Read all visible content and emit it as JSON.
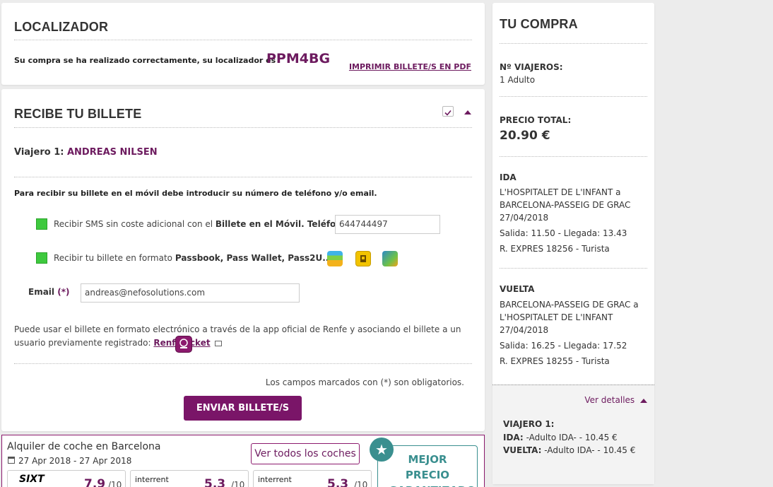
{
  "localizador": {
    "title": "LOCALIZADOR",
    "message": "Su compra se ha realizado correctamente, su localizador es",
    "code": "PPM4BG",
    "print_link": "IMPRIMIR BILLETE/S EN PDF"
  },
  "recibe": {
    "title": "RECIBE TU BILLETE",
    "viajero_label": "Viajero 1:",
    "viajero_name": "ANDREAS NILSEN",
    "instructions": "Para recibir su billete en el móvil debe introducir su número de teléfono y/o email.",
    "sms_text_prefix": "Recibir SMS sin coste adicional con el",
    "sms_text_bold": "Billete en el Móvil. Teléfono",
    "sms_required": "(*)",
    "phone_value": "644744497",
    "passbook_text_prefix": "Recibir tu billete en formato",
    "passbook_text_bold": "Passbook, Pass Wallet, Pass2U....",
    "email_label": "Email",
    "email_required": "(*)",
    "email_value": "andreas@nefosolutions.com",
    "app_text": "Puede usar el billete en formato electrónico a través de la app oficial de Renfe y asociando el billete a un usuario previamente registrado:",
    "app_link": "RenfeTicket",
    "required_note": "Los campos marcados con (*) son obligatorios.",
    "send_button": "ENVIAR BILLETE/S"
  },
  "car_rental": {
    "title": "Alquiler de coche en Barcelona",
    "dates": "27 Apr 2018 -  27 Apr 2018",
    "view_all": "Ver todos los coches",
    "badge": "MEJOR PRECIO GARANTIZADO",
    "providers": [
      {
        "name": "SIXT",
        "score": "7.9",
        "max": "/10"
      },
      {
        "name": "interrent",
        "score": "5.3",
        "max": "/10"
      },
      {
        "name": "interrent",
        "score": "5.3",
        "max": "/10"
      }
    ]
  },
  "compra": {
    "title": "TU COMPRA",
    "viajeros_label": "Nº VIAJEROS:",
    "viajeros_value": "1 Adulto",
    "precio_label": "PRECIO TOTAL:",
    "precio_value": "20.90 €",
    "ida": {
      "label": "IDA",
      "route": "L'HOSPITALET DE L'INFANT a BARCELONA-PASSEIG DE GRAC",
      "date": "27/04/2018",
      "times": "Salida: 11.50 - Llegada: 13.43",
      "train": "R. EXPRES 18256 - Turista"
    },
    "vuelta": {
      "label": "VUELTA",
      "route": "BARCELONA-PASSEIG DE GRAC a L'HOSPITALET DE L'INFANT",
      "date": "27/04/2018",
      "times": "Salida: 16.25 - Llegada: 17.52",
      "train": "R. EXPRES 18255 - Turista"
    },
    "details_link": "Ver detalles",
    "detail_viajero": "VIAJERO 1:",
    "detail_ida_label": "IDA:",
    "detail_ida_value": "-Adulto IDA- - 10.45 €",
    "detail_vuelta_label": "VUELTA:",
    "detail_vuelta_value": "-Adulto IDA- - 10.45 €"
  },
  "colors": {
    "accent": "#6d1b5f",
    "button": "#7a1568",
    "check": "#3ec93e",
    "badge": "#3a8f8f"
  }
}
